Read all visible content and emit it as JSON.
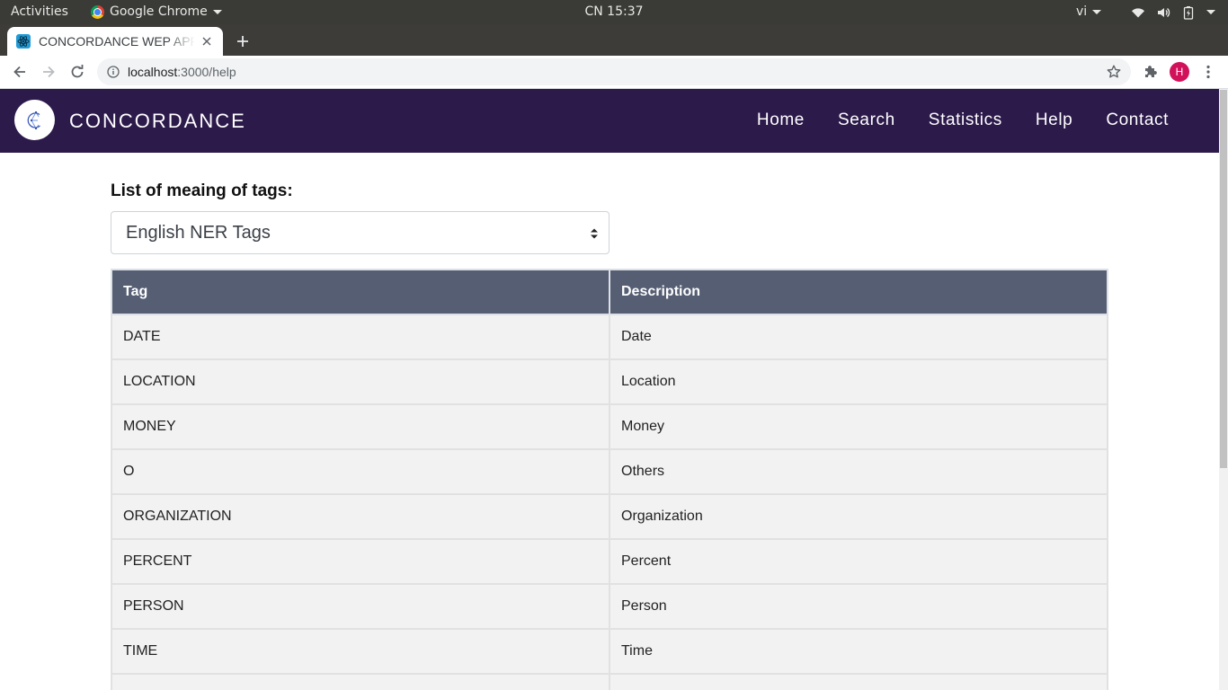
{
  "system_bar": {
    "activities": "Activities",
    "app_name": "Google Chrome",
    "clock": "CN 15:37",
    "language": "vi"
  },
  "browser": {
    "tab_title": "CONCORDANCE WEP APP",
    "url_host": "localhost",
    "url_path": ":3000/help",
    "profile_initial": "H"
  },
  "navbar": {
    "brand": "CONCORDANCE",
    "links": [
      "Home",
      "Search",
      "Statistics",
      "Help",
      "Contact"
    ]
  },
  "help": {
    "label": "List of meaing of tags:",
    "select_value": "English NER Tags",
    "table": {
      "headers": [
        "Tag",
        "Description"
      ],
      "rows": [
        [
          "DATE",
          "Date"
        ],
        [
          "LOCATION",
          "Location"
        ],
        [
          "MONEY",
          "Money"
        ],
        [
          "O",
          "Others"
        ],
        [
          "ORGANIZATION",
          "Organization"
        ],
        [
          "PERCENT",
          "Percent"
        ],
        [
          "PERSON",
          "Person"
        ],
        [
          "TIME",
          "Time"
        ],
        [
          "",
          ""
        ]
      ]
    }
  },
  "colors": {
    "navbar_bg": "#2c1a4b",
    "table_header_bg": "#555e73",
    "table_row_bg": "#f2f2f2",
    "avatar_bg": "#d1115a"
  }
}
